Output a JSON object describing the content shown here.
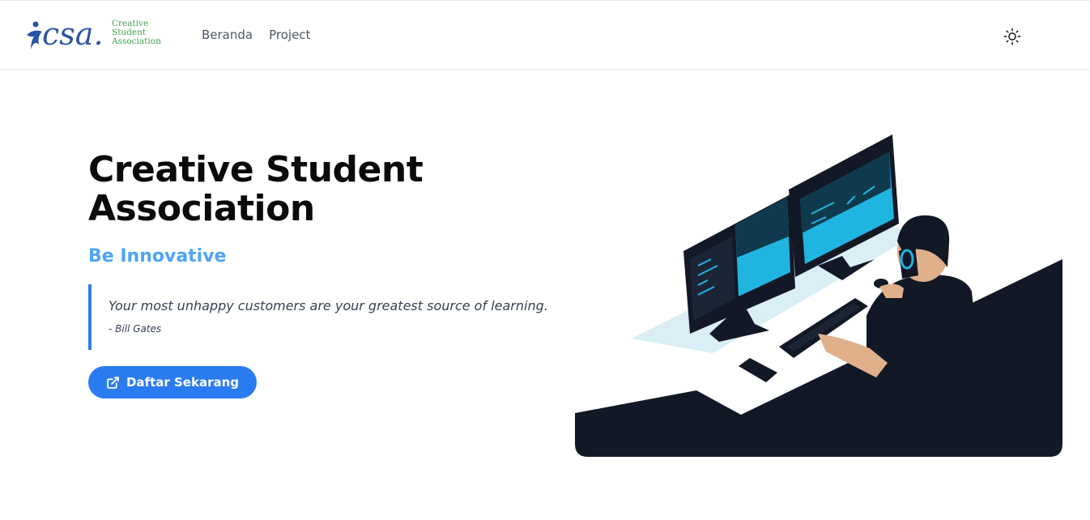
{
  "navbar": {
    "logo": {
      "mark_text": "csa.",
      "text_lines": [
        "Creative",
        "Student",
        "Association"
      ]
    },
    "links": [
      {
        "label": "Beranda"
      },
      {
        "label": "Project"
      }
    ],
    "theme_toggle_icon": "sun-icon"
  },
  "hero": {
    "title": "Creative Student Association",
    "tagline": "Be Innovative",
    "quote": {
      "text": "Your most unhappy customers are your greatest source of learning.",
      "author": "- Bill Gates"
    },
    "cta": {
      "label": "Daftar Sekarang",
      "icon": "external-link-icon"
    },
    "illustration": "person-at-dual-monitors-illustration"
  },
  "colors": {
    "accent": "#2b7bf0",
    "tagline": "#4fa3f7",
    "quote_border": "#2f7de1",
    "logo_blue": "#2b55a3",
    "logo_green": "#3aa14a",
    "illustration_dark": "#121826",
    "illustration_cyan": "#20b5e0"
  }
}
